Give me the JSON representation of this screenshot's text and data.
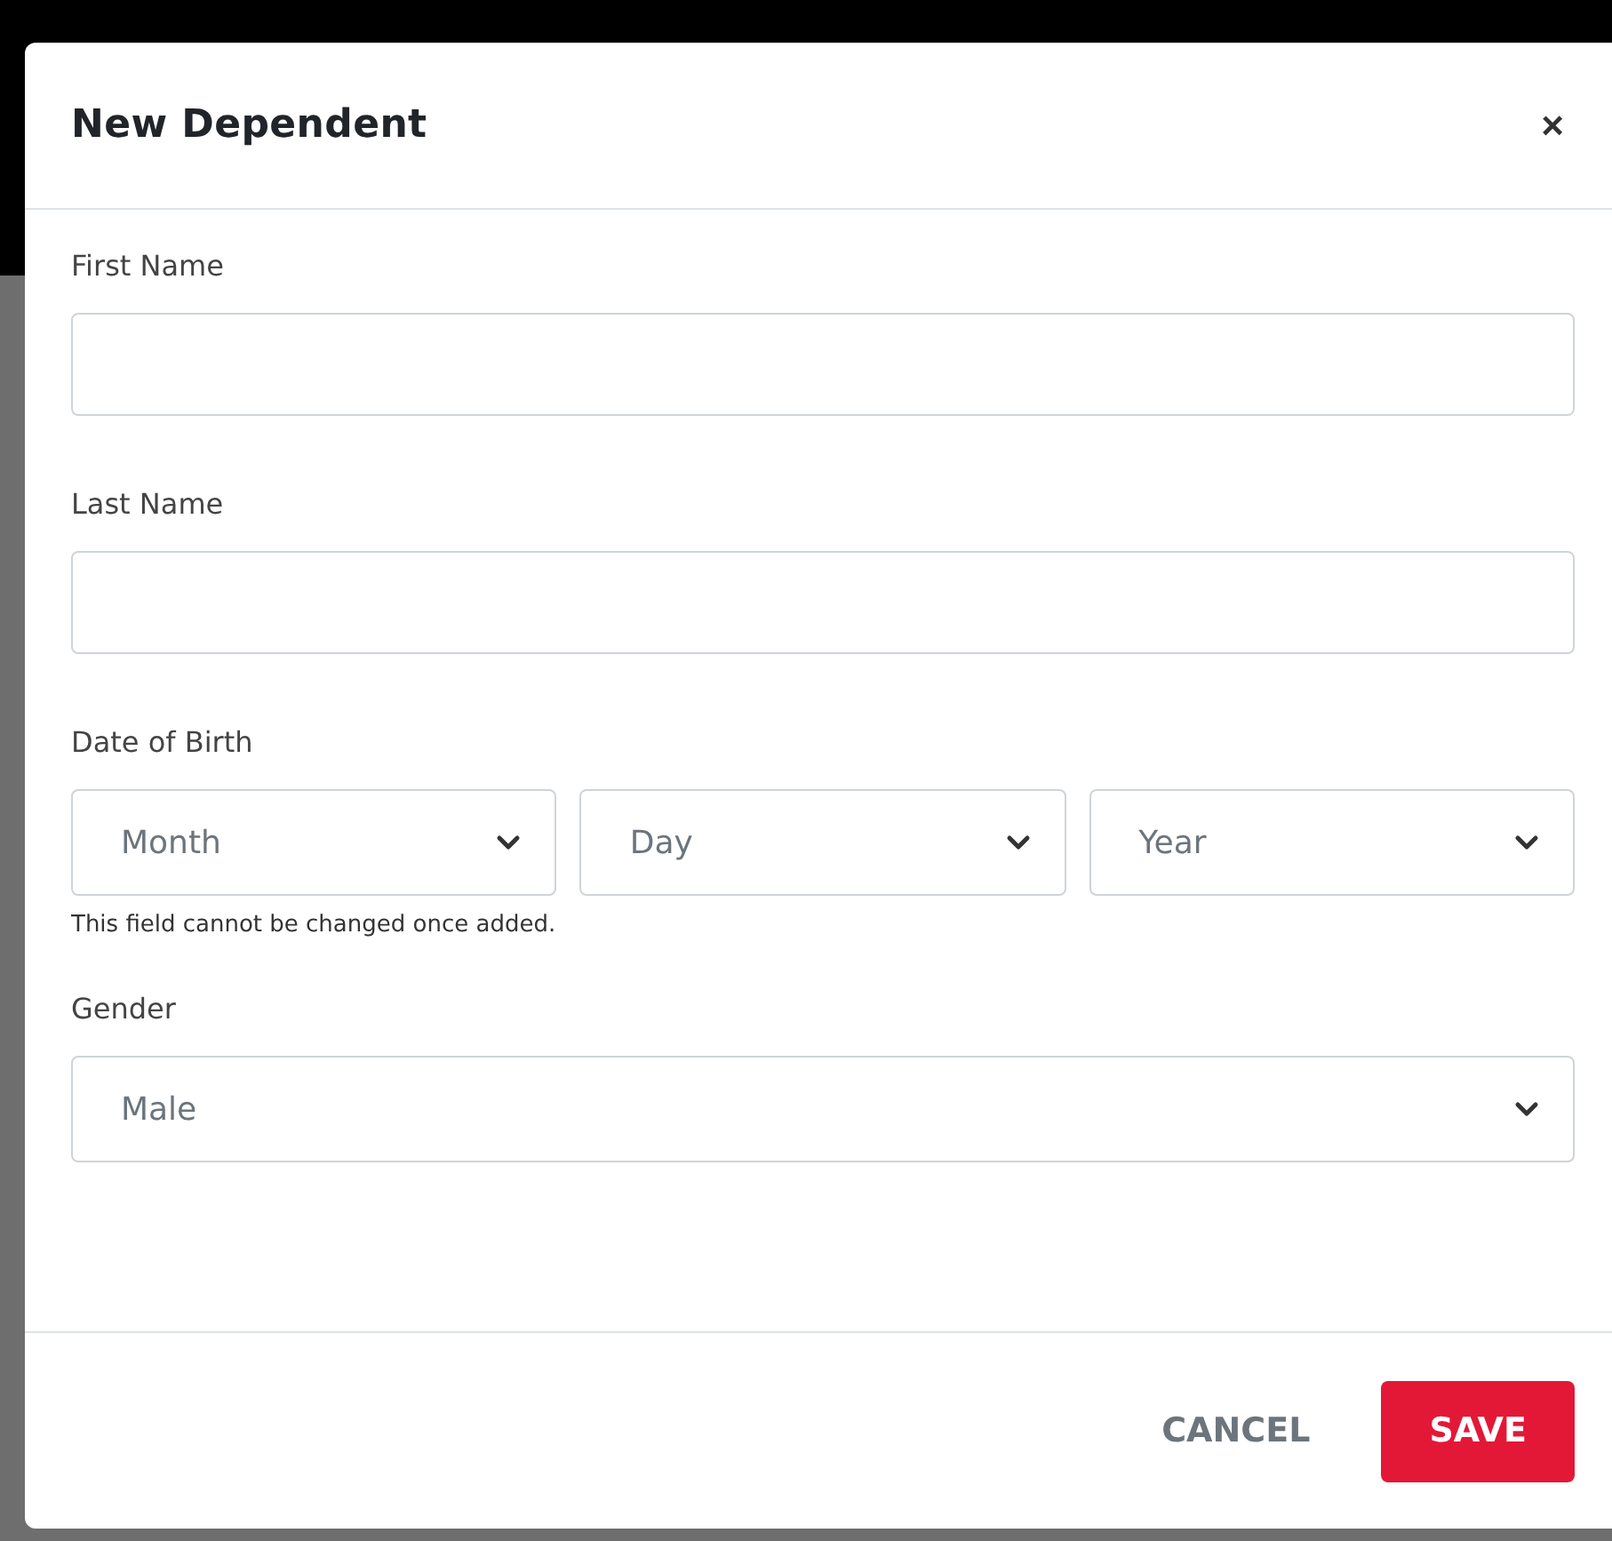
{
  "dialog": {
    "title": "New Dependent",
    "close": "×",
    "fields": [
      {
        "kind": "text",
        "label": "First Name"
      },
      {
        "kind": "text",
        "label": "Last Name"
      },
      {
        "kind": "date",
        "label": "Date of Birth",
        "selects": [
          "Month",
          "Day",
          "Year"
        ],
        "help": "This field cannot be changed once added."
      },
      {
        "kind": "select",
        "label": "Gender",
        "value": "Male"
      }
    ],
    "buttons": [
      {
        "kind": "secondary",
        "label": "CANCEL"
      },
      {
        "kind": "primary",
        "label": "SAVE"
      }
    ]
  }
}
